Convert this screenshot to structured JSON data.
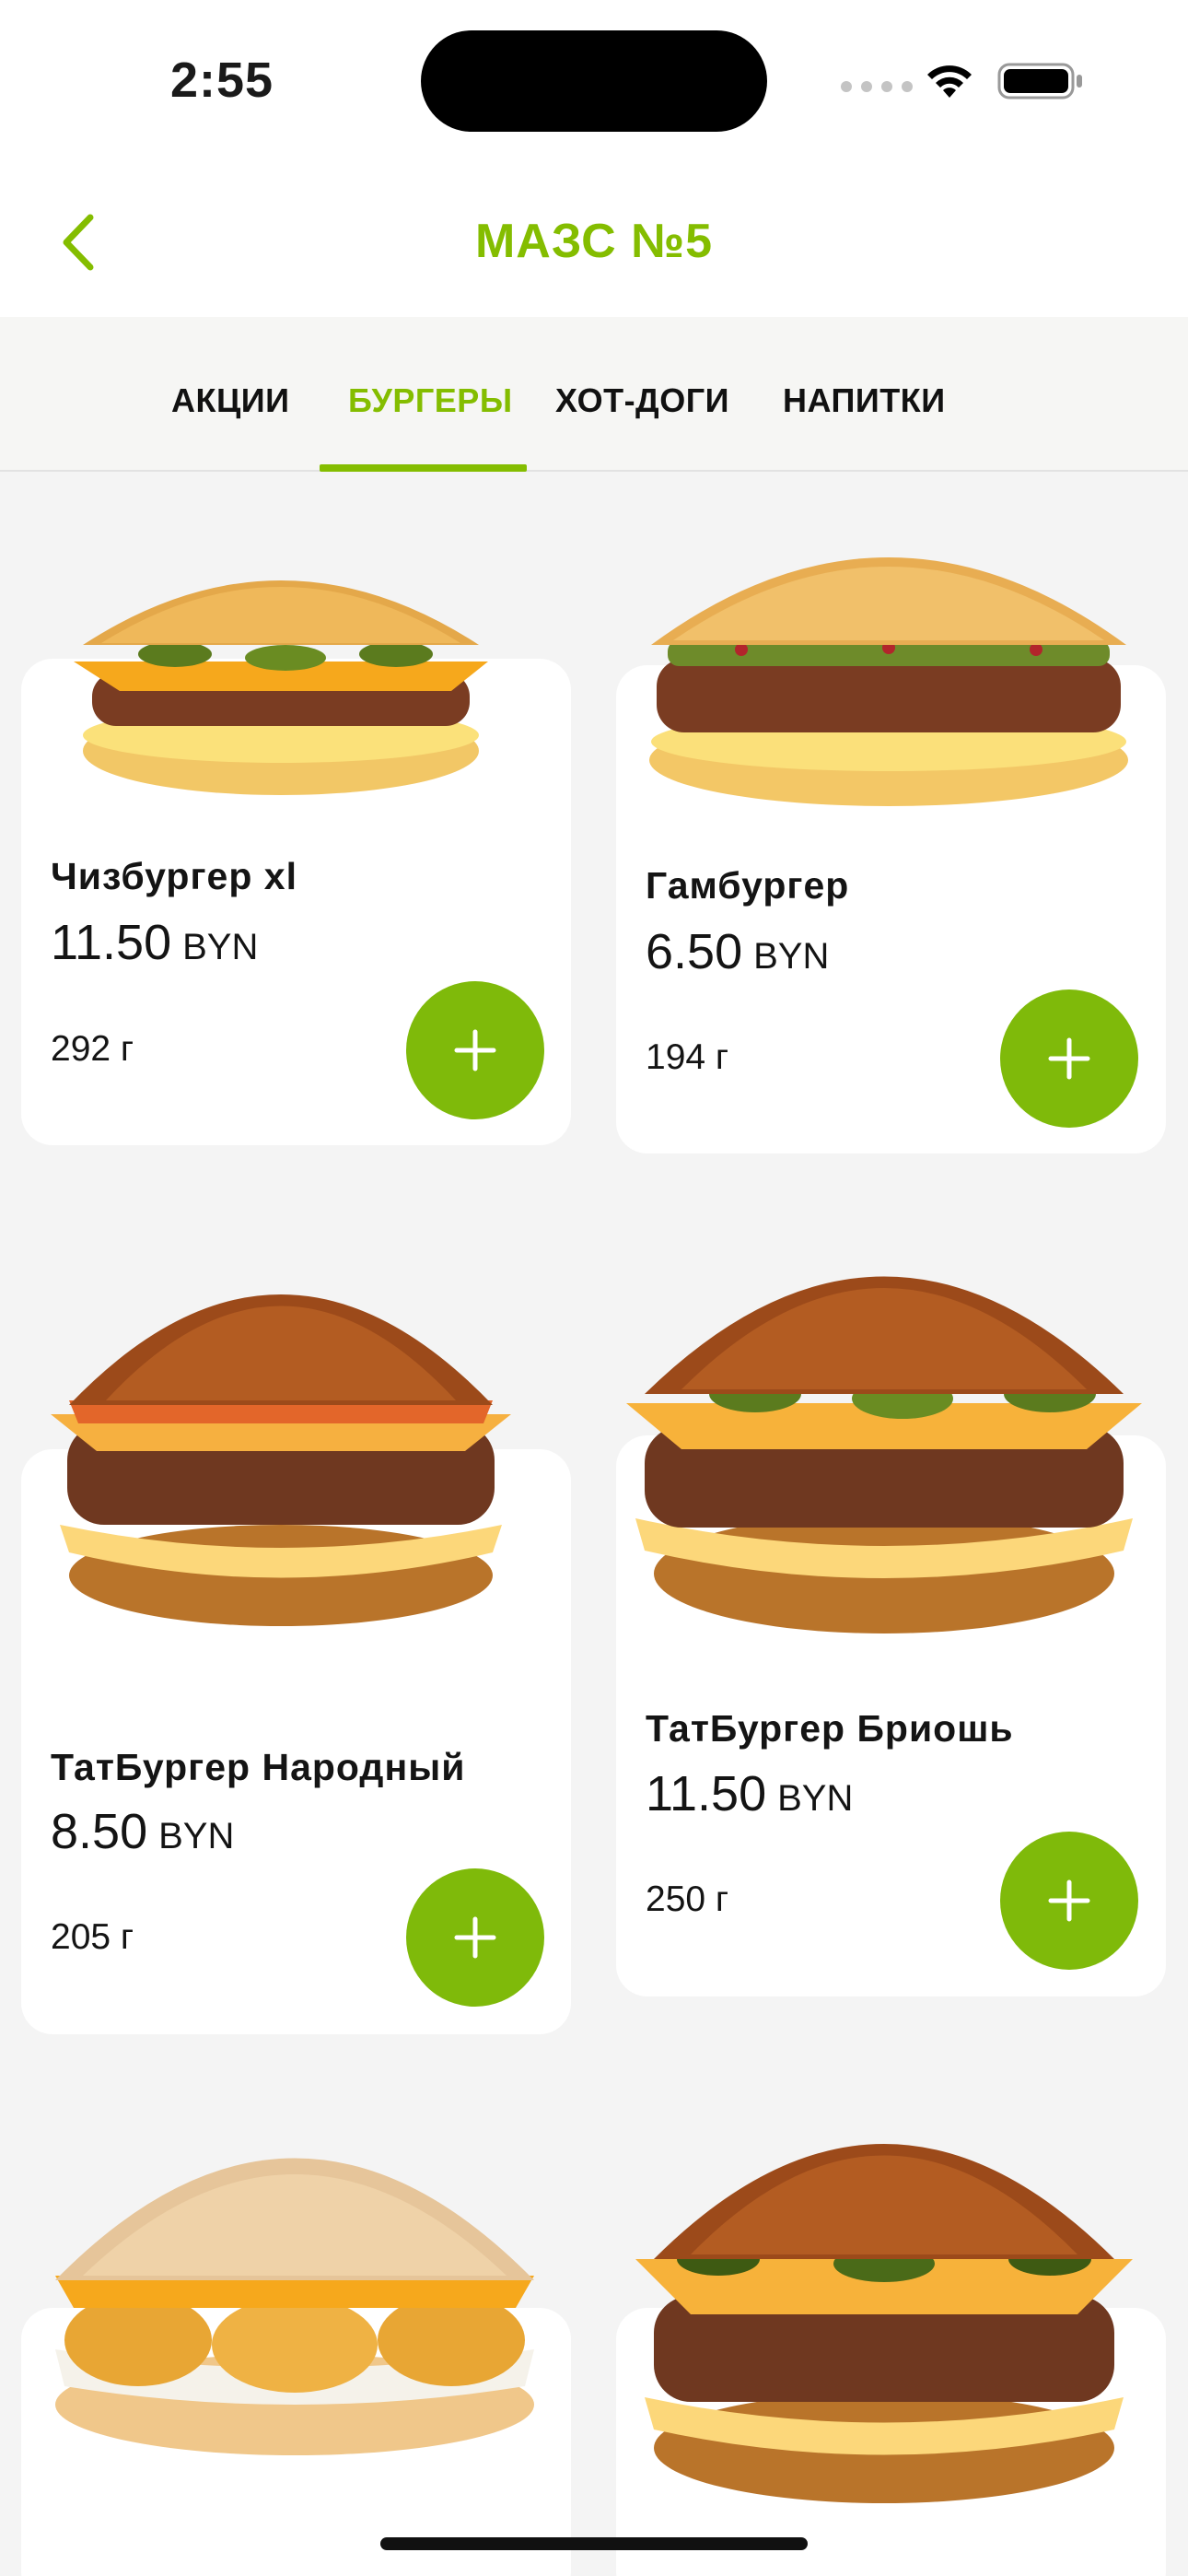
{
  "status": {
    "time": "2:55"
  },
  "header": {
    "title": "МАЗС №5"
  },
  "tabs": [
    {
      "label": "АКЦИИ"
    },
    {
      "label": "БУРГЕРЫ",
      "active": true
    },
    {
      "label": "ХОТ-ДОГИ"
    },
    {
      "label": "НАПИТКИ"
    }
  ],
  "products": [
    {
      "name": "Чизбургер xl",
      "price": "11.50",
      "currency": "BYN",
      "weight": "292 г"
    },
    {
      "name": "Гамбургер",
      "price": "6.50",
      "currency": "BYN",
      "weight": "194 г"
    },
    {
      "name": "ТатБургер Народный",
      "price": "8.50",
      "currency": "BYN",
      "weight": "205 г"
    },
    {
      "name": "ТатБургер Бриошь",
      "price": "11.50",
      "currency": "BYN",
      "weight": "250 г"
    }
  ],
  "colors": {
    "accent": "#84bd00",
    "button": "#7fba0a",
    "background": "#f4f4f4"
  },
  "icons": [
    "back-chevron-icon",
    "wifi-icon",
    "battery-icon",
    "plus-icon"
  ]
}
